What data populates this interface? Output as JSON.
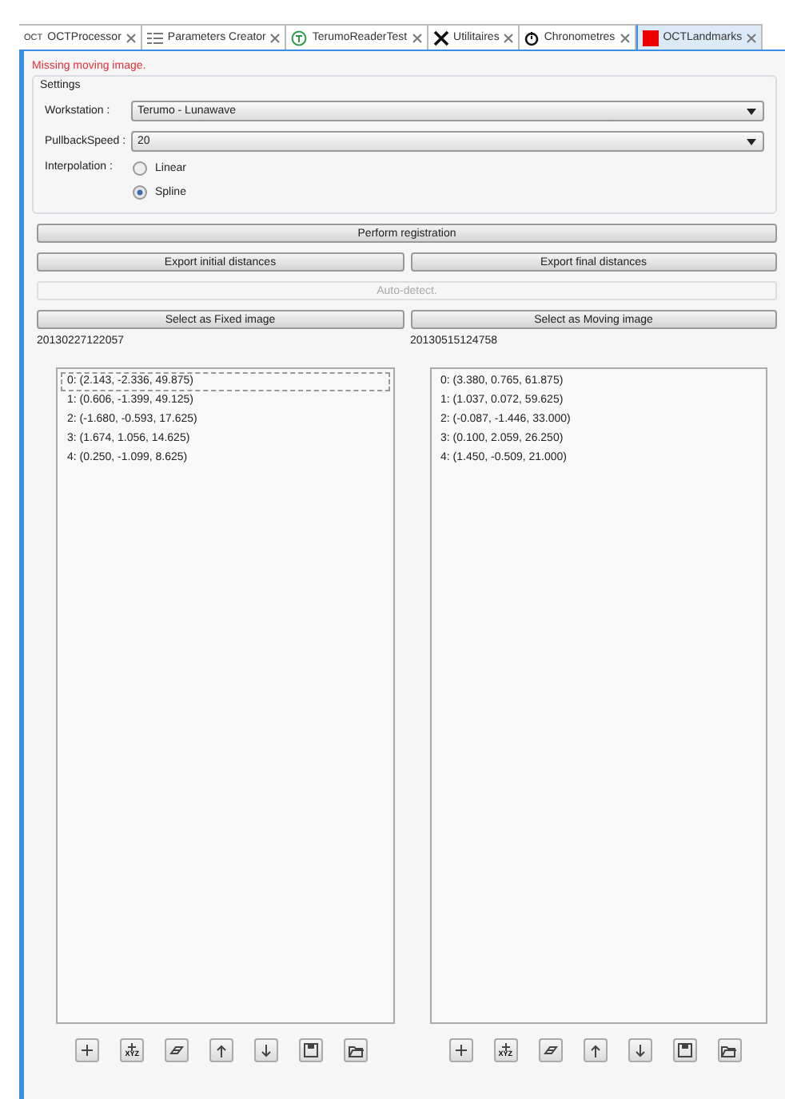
{
  "tabs": [
    {
      "label": "OCTProcessor",
      "kind": "oct",
      "icon_text": "OCT",
      "selected": false
    },
    {
      "label": "Parameters Creator",
      "kind": "grid",
      "selected": false
    },
    {
      "label": "TerumoReaderTest",
      "kind": "circle",
      "selected": false
    },
    {
      "label": "Utilitaires",
      "kind": "tools",
      "selected": false
    },
    {
      "label": "Chronometres",
      "kind": "timer",
      "selected": false
    },
    {
      "label": "OCTLandmarks",
      "kind": "square",
      "selected": true
    }
  ],
  "message": "Missing moving image.",
  "settings": {
    "title": "Settings",
    "workstation": {
      "label": "Workstation :",
      "value": "Terumo - Lunawave"
    },
    "pullback_speed": {
      "label": "PullbackSpeed :",
      "value": "20"
    },
    "interpolation": {
      "label": "Interpolation :",
      "options": [
        {
          "label": "Linear",
          "selected": false
        },
        {
          "label": "Spline",
          "selected": true
        }
      ]
    }
  },
  "perform_button": {
    "label": "Perform registration",
    "disabled": false
  },
  "export_buttons": [
    {
      "label": "Export initial distances",
      "disabled": false
    },
    {
      "label": "Export final distances",
      "disabled": false
    }
  ],
  "auto_detect_button": {
    "label": "Auto-detect.",
    "disabled": true
  },
  "panels": [
    {
      "select_label": "Select as Fixed image",
      "image_id": "20130227122057",
      "points": [
        {
          "text": "0: (2.143, -2.336, 49.875)",
          "selected": true
        },
        {
          "text": "1: (0.606, -1.399, 49.125)",
          "selected": false
        },
        {
          "text": "2: (-1.680, -0.593, 17.625)",
          "selected": false
        },
        {
          "text": "3: (1.674, 1.056, 14.625)",
          "selected": false
        },
        {
          "text": "4: (0.250, -1.099, 8.625)",
          "selected": false
        }
      ],
      "toolbar": [
        {
          "kind": "add"
        },
        {
          "kind": "add-xyz",
          "label": "XYZ"
        },
        {
          "kind": "erase"
        },
        {
          "kind": "up"
        },
        {
          "kind": "down"
        },
        {
          "kind": "save"
        },
        {
          "kind": "open"
        }
      ]
    },
    {
      "select_label": "Select as Moving image",
      "image_id": "20130515124758",
      "points": [
        {
          "text": "0: (3.380, 0.765, 61.875)",
          "selected": false
        },
        {
          "text": "1: (1.037, 0.072, 59.625)",
          "selected": false
        },
        {
          "text": "2: (-0.087, -1.446, 33.000)",
          "selected": false
        },
        {
          "text": "3: (0.100, 2.059, 26.250)",
          "selected": false
        },
        {
          "text": "4: (1.450, -0.509, 21.000)",
          "selected": false
        }
      ],
      "toolbar": [
        {
          "kind": "add"
        },
        {
          "kind": "add-xyz",
          "label": "XYZ"
        },
        {
          "kind": "erase"
        },
        {
          "kind": "up"
        },
        {
          "kind": "down"
        },
        {
          "kind": "save"
        },
        {
          "kind": "open"
        }
      ]
    }
  ]
}
